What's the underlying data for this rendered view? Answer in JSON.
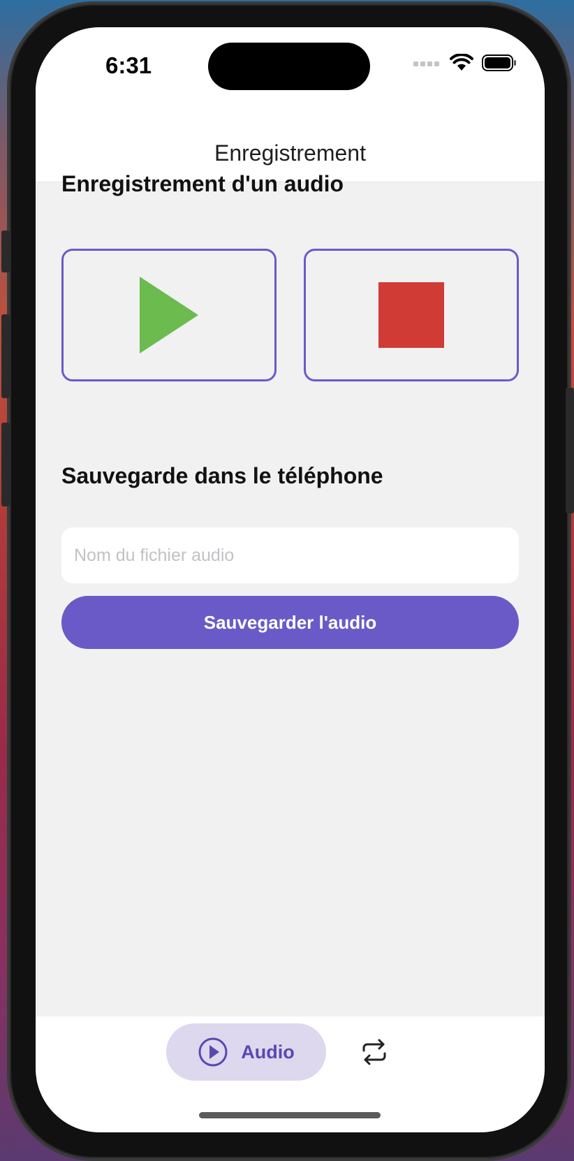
{
  "status_bar": {
    "time": "6:31"
  },
  "header": {
    "title": "Enregistrement"
  },
  "recording": {
    "heading": "Enregistrement d'un audio",
    "play_icon": "play-icon",
    "stop_icon": "stop-icon"
  },
  "saving": {
    "heading": "Sauvegarde dans le téléphone",
    "filename_placeholder": "Nom du fichier audio",
    "filename_value": "",
    "save_label": "Sauvegarder l'audio"
  },
  "tab_bar": {
    "tabs": [
      {
        "label": "Audio",
        "icon": "play-circle-icon",
        "active": true
      },
      {
        "label": "",
        "icon": "repeat-icon",
        "active": false
      }
    ]
  },
  "colors": {
    "accent": "#6a5ac7",
    "play_green": "#6bbb4f",
    "stop_red": "#d03c35",
    "background": "#f1f1f2",
    "active_tab_bg": "#ddd8ee"
  }
}
